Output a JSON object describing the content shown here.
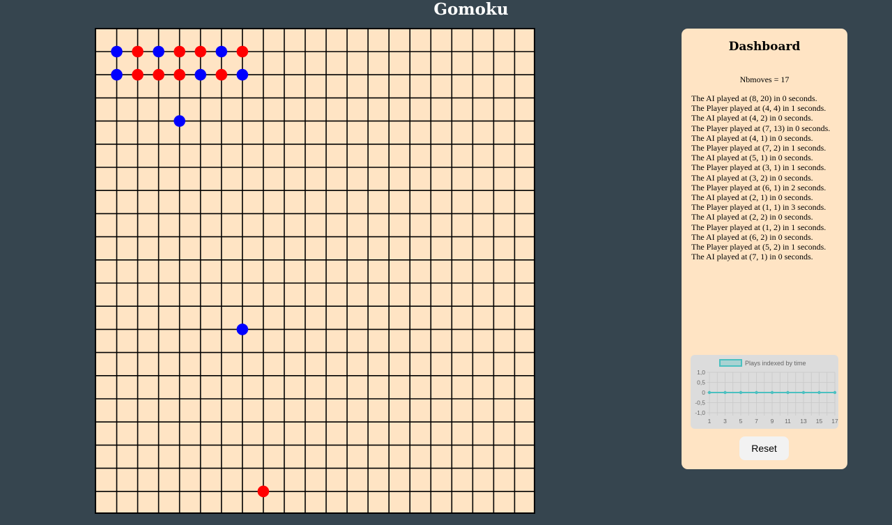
{
  "title": "Gomoku",
  "colors": {
    "player": "#ff0000",
    "ai": "#0000ff",
    "board": "#ffe4c4",
    "line": "#000000",
    "background": "#36454f"
  },
  "board": {
    "stones": [
      {
        "row": 1,
        "col": 1,
        "color": "blue"
      },
      {
        "row": 1,
        "col": 2,
        "color": "red"
      },
      {
        "row": 1,
        "col": 3,
        "color": "blue"
      },
      {
        "row": 1,
        "col": 4,
        "color": "red"
      },
      {
        "row": 1,
        "col": 5,
        "color": "red"
      },
      {
        "row": 1,
        "col": 6,
        "color": "blue"
      },
      {
        "row": 1,
        "col": 7,
        "color": "red"
      },
      {
        "row": 2,
        "col": 1,
        "color": "blue"
      },
      {
        "row": 2,
        "col": 2,
        "color": "red"
      },
      {
        "row": 2,
        "col": 3,
        "color": "red"
      },
      {
        "row": 2,
        "col": 4,
        "color": "red"
      },
      {
        "row": 2,
        "col": 5,
        "color": "blue"
      },
      {
        "row": 2,
        "col": 6,
        "color": "red"
      },
      {
        "row": 2,
        "col": 7,
        "color": "blue"
      },
      {
        "row": 4,
        "col": 4,
        "color": "blue"
      },
      {
        "row": 13,
        "col": 7,
        "color": "blue"
      },
      {
        "row": 20,
        "col": 8,
        "color": "red"
      }
    ]
  },
  "dashboard": {
    "title": "Dashboard",
    "nbmoves": "Nbmoves = 17",
    "log": [
      "The AI played at (8, 20) in 0 seconds.",
      "The Player played at (4, 4) in 1 seconds.",
      "The AI played at (4, 2) in 0 seconds.",
      "The Player played at (7, 13) in 0 seconds.",
      "The AI played at (4, 1) in 0 seconds.",
      "The Player played at (7, 2) in 1 seconds.",
      "The AI played at (5, 1) in 0 seconds.",
      "The Player played at (3, 1) in 1 seconds.",
      "The AI played at (3, 2) in 0 seconds.",
      "The Player played at (6, 1) in 2 seconds.",
      "The AI played at (2, 1) in 0 seconds.",
      "The Player played at (1, 1) in 3 seconds.",
      "The AI played at (2, 2) in 0 seconds.",
      "The Player played at (1, 2) in 1 seconds.",
      "The AI played at (6, 2) in 0 seconds.",
      "The Player played at (5, 2) in 1 seconds.",
      "The AI played at (7, 1) in 0 seconds."
    ],
    "reset_label": "Reset"
  },
  "chart_data": {
    "type": "line",
    "legend": "Plays indexed by time",
    "x": [
      1,
      2,
      3,
      4,
      5,
      6,
      7,
      8,
      9,
      10,
      11,
      12,
      13,
      14,
      15,
      16,
      17
    ],
    "x_tick_labels": [
      "1",
      "3",
      "5",
      "7",
      "9",
      "11",
      "13",
      "15",
      "17"
    ],
    "y_tick_labels": [
      "1,0",
      "0,5",
      "0",
      "-0,5",
      "-1,0"
    ],
    "values": [
      0,
      0,
      0,
      0,
      0,
      0,
      0,
      0,
      0,
      0,
      0,
      0,
      0,
      0,
      0,
      0,
      0
    ],
    "ylim": [
      -1,
      1
    ],
    "color": "#4bc0c0",
    "legend_placement": "top"
  }
}
